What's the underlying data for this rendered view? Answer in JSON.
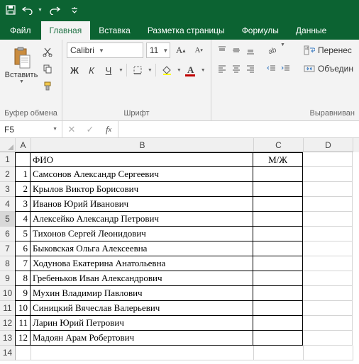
{
  "qat": {
    "save": "save",
    "undo": "undo",
    "redo": "redo"
  },
  "tabs": {
    "file": "Файл",
    "home": "Главная",
    "insert": "Вставка",
    "layout": "Разметка страницы",
    "formulas": "Формулы",
    "data": "Данные"
  },
  "ribbon": {
    "clipboard": {
      "paste": "Вставить",
      "label": "Буфер обмена"
    },
    "font": {
      "name": "Calibri",
      "size": "11",
      "label": "Шрифт",
      "bold": "Ж",
      "italic": "К",
      "underline": "Ч"
    },
    "align": {
      "wrap": "Перенес",
      "merge": "Объедин",
      "label": "Выравниван"
    }
  },
  "formula_bar": {
    "name_box": "F5",
    "value": ""
  },
  "columns": [
    "A",
    "B",
    "C",
    "D"
  ],
  "headers": {
    "b": "ФИО",
    "c": "М/Ж"
  },
  "rows": [
    {
      "n": 1,
      "fio": "Самсонов Александр Сергеевич"
    },
    {
      "n": 2,
      "fio": "Крылов Виктор Борисович"
    },
    {
      "n": 3,
      "fio": "Иванов Юрий Иванович"
    },
    {
      "n": 4,
      "fio": "Алексейко Александр Петрович"
    },
    {
      "n": 5,
      "fio": "Тихонов Сергей Леонидович"
    },
    {
      "n": 6,
      "fio": "Быковская Ольга Алексеевна"
    },
    {
      "n": 7,
      "fio": "Ходунова Екатерина Анатольевна"
    },
    {
      "n": 8,
      "fio": "Гребеньков Иван Александрович"
    },
    {
      "n": 9,
      "fio": "Мухин Владимир Павлович"
    },
    {
      "n": 10,
      "fio": "Синицкий Вячеслав Валерьевич"
    },
    {
      "n": 11,
      "fio": "Ларин Юрий Петрович"
    },
    {
      "n": 12,
      "fio": "Мадоян Арам Робертович"
    }
  ],
  "selected_row": 5
}
